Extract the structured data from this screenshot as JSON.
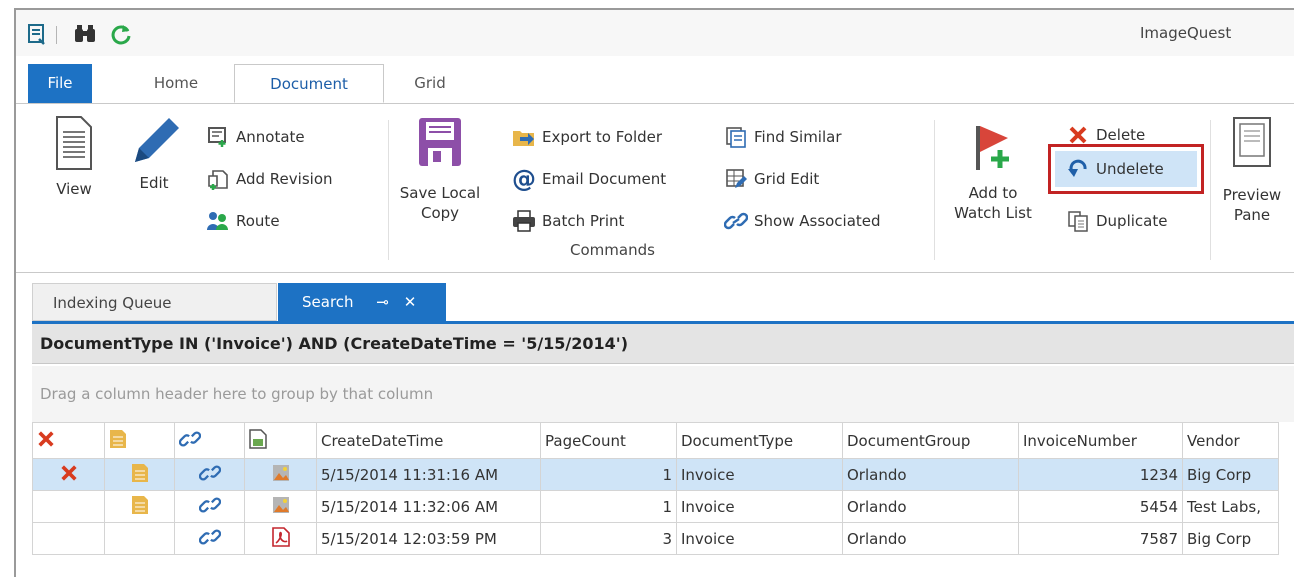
{
  "app": {
    "title": "ImageQuest"
  },
  "tabs": {
    "file": "File",
    "home": "Home",
    "document": "Document",
    "grid": "Grid"
  },
  "ribbon": {
    "view": "View",
    "edit": "Edit",
    "annotate": "Annotate",
    "add_revision": "Add Revision",
    "route": "Route",
    "save_local_line1": "Save Local",
    "save_local_line2": "Copy",
    "export_to_folder": "Export to Folder",
    "email_document": "Email Document",
    "batch_print": "Batch Print",
    "find_similar": "Find Similar",
    "grid_edit": "Grid Edit",
    "show_associated": "Show Associated",
    "add_watch_line1": "Add to",
    "add_watch_line2": "Watch List",
    "delete": "Delete",
    "undelete": "Undelete",
    "duplicate": "Duplicate",
    "preview_line1": "Preview",
    "preview_line2": "Pane",
    "group_commands": "Commands"
  },
  "doc_tabs": {
    "queue": "Indexing Queue",
    "search": "Search",
    "pin": "⊸",
    "close": "✕"
  },
  "query": "DocumentType IN ('Invoice') AND (CreateDateTime = '5/15/2014')",
  "group_hint": "Drag a column header here to group by that column",
  "grid": {
    "headers": [
      "CreateDateTime",
      "PageCount",
      "DocumentType",
      "DocumentGroup",
      "InvoiceNumber",
      "Vendor"
    ],
    "rows": [
      {
        "created": "5/15/2014 11:31:16 AM",
        "pages": "1",
        "type": "Invoice",
        "group": "Orlando",
        "invoice": "1234",
        "vendor": "Big Corp",
        "deleted": true,
        "has_notes": true,
        "file_icon": "image-file-icon"
      },
      {
        "created": "5/15/2014 11:32:06 AM",
        "pages": "1",
        "type": "Invoice",
        "group": "Orlando",
        "invoice": "5454",
        "vendor": "Test Labs,",
        "deleted": false,
        "has_notes": true,
        "file_icon": "image-file-icon"
      },
      {
        "created": "5/15/2014 12:03:59 PM",
        "pages": "3",
        "type": "Invoice",
        "group": "Orlando",
        "invoice": "7587",
        "vendor": "Big Corp",
        "deleted": false,
        "has_notes": false,
        "file_icon": "pdf-file-icon"
      }
    ]
  },
  "colors": {
    "accent": "#1d72c4",
    "selection": "#cfe4f7",
    "highlight_border": "#c22323",
    "delete_red": "#d83b1f"
  }
}
